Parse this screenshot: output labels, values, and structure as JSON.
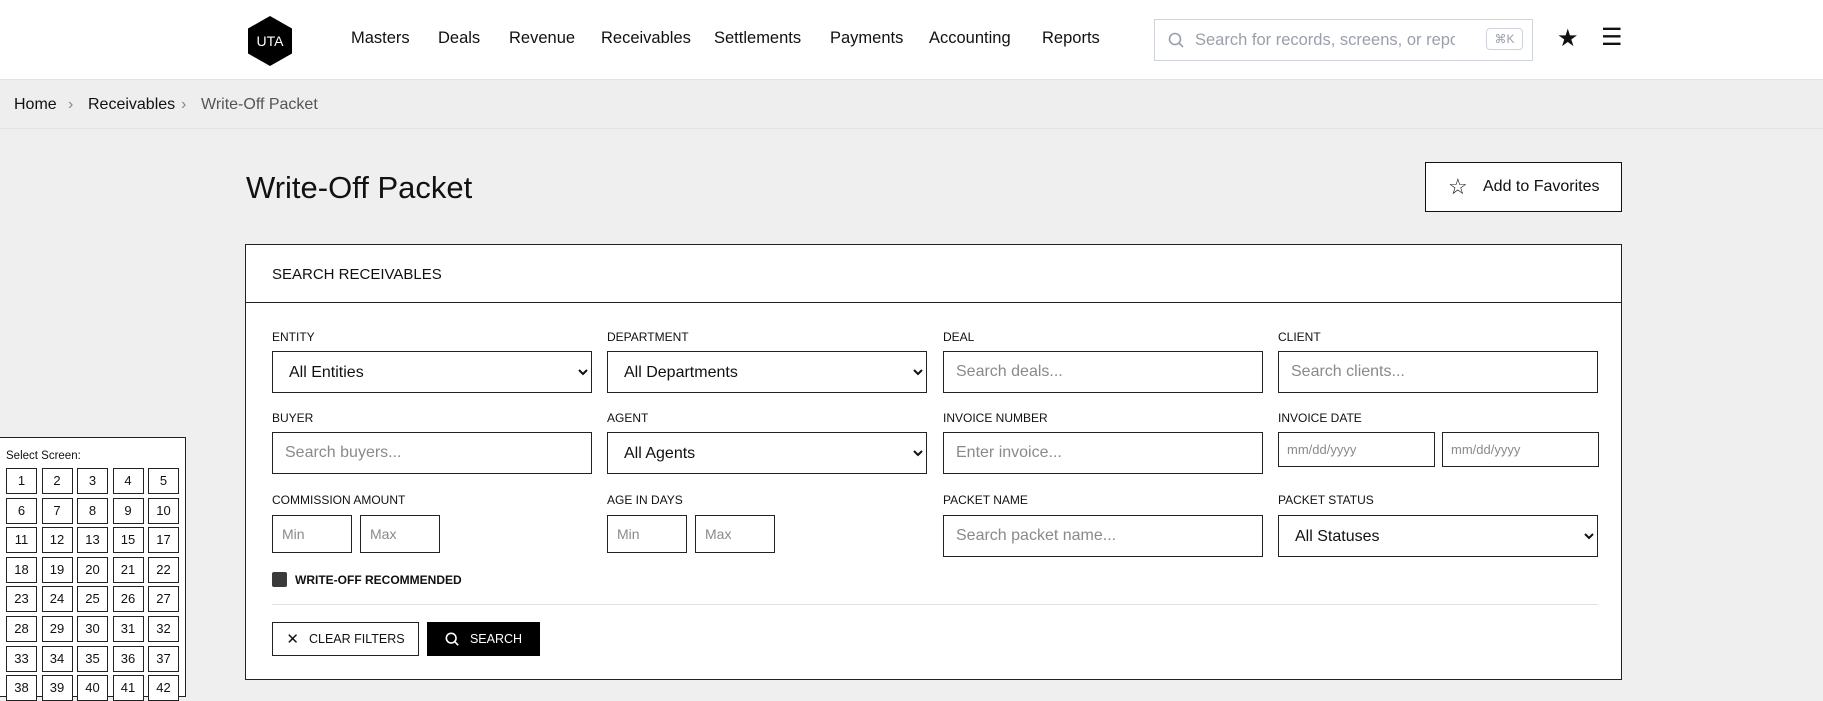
{
  "header": {
    "logo": "UTA",
    "nav": [
      "Masters",
      "Deals",
      "Revenue",
      "Receivables",
      "Settlements",
      "Payments",
      "Accounting",
      "Reports"
    ],
    "search_placeholder": "Search for records, screens, or reports",
    "shortcut": "⌘K"
  },
  "breadcrumb": {
    "items": [
      "Home",
      "Receivables",
      "Write-Off Packet"
    ],
    "separator": "›"
  },
  "page": {
    "title": "Write-Off Packet",
    "add_favorites": "Add to Favorites"
  },
  "card": {
    "title": "SEARCH RECEIVABLES",
    "entity": {
      "label": "ENTITY",
      "value": "All Entities"
    },
    "department": {
      "label": "DEPARTMENT",
      "value": "All Departments"
    },
    "deal": {
      "label": "DEAL",
      "placeholder": "Search deals..."
    },
    "client": {
      "label": "CLIENT",
      "placeholder": "Search clients..."
    },
    "buyer": {
      "label": "BUYER",
      "placeholder": "Search buyers..."
    },
    "agent": {
      "label": "AGENT",
      "value": "All Agents"
    },
    "invoice_number": {
      "label": "INVOICE NUMBER",
      "placeholder": "Enter invoice..."
    },
    "invoice_date": {
      "label": "INVOICE DATE",
      "from": "mm/dd/yyyy",
      "to": "mm/dd/yyyy"
    },
    "commission": {
      "label": "COMMISSION AMOUNT",
      "min": "Min",
      "max": "Max"
    },
    "age": {
      "label": "AGE IN DAYS",
      "min": "Min",
      "max": "Max"
    },
    "packet_name": {
      "label": "PACKET NAME",
      "placeholder": "Search packet name..."
    },
    "packet_status": {
      "label": "PACKET STATUS",
      "value": "All Statuses"
    },
    "write_off": {
      "label": "WRITE-OFF RECOMMENDED",
      "checked": true
    },
    "clear": "CLEAR FILTERS",
    "search": "SEARCH"
  },
  "screen_panel": {
    "label": "Select Screen:",
    "screens": [
      "1",
      "2",
      "3",
      "4",
      "5",
      "6",
      "7",
      "8",
      "9",
      "10",
      "11",
      "12",
      "13",
      "15",
      "17",
      "18",
      "19",
      "20",
      "21",
      "22",
      "23",
      "24",
      "25",
      "26",
      "27",
      "28",
      "29",
      "30",
      "31",
      "32",
      "33",
      "34",
      "35",
      "36",
      "37",
      "38",
      "39",
      "40",
      "41",
      "42"
    ]
  }
}
